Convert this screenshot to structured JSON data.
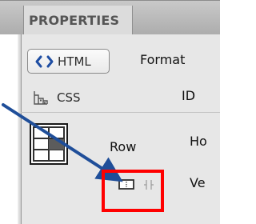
{
  "panel": {
    "title": "PROPERTIES",
    "html_button_label": "HTML",
    "css_button_label": "CSS",
    "format_label": "Format",
    "id_label": "ID",
    "row_label": "Row",
    "horizontal_label_partial": "Ho",
    "vertical_label_partial": "Ve"
  },
  "icons": {
    "html": "code-brackets-icon",
    "css": "css-layout-icon",
    "table": "table-cell-icon",
    "merge": "merge-cells-icon",
    "split": "split-cells-icon"
  },
  "colors": {
    "highlight": "#ff0000",
    "annotation_arrow": "#1f4e99",
    "html_icon": "#1f4ea3"
  }
}
